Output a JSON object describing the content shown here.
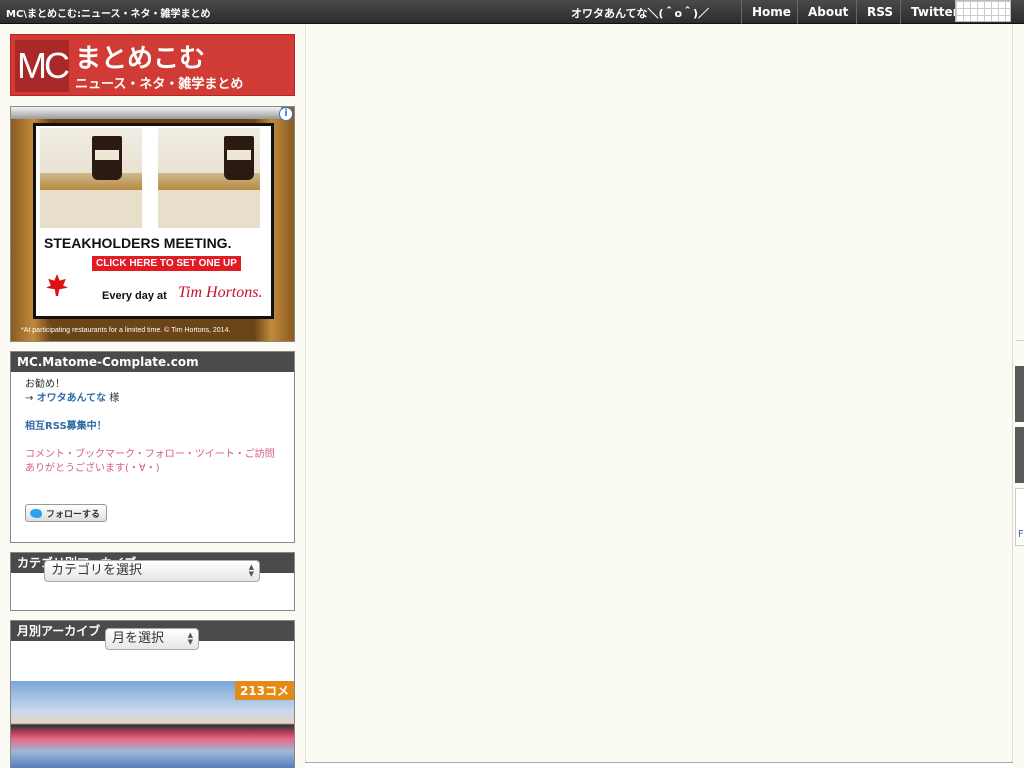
{
  "topbar": {
    "site_title": "MC\\まとめこむ:ニュース・ネタ・雑学まとめ",
    "tagline": "オワタあんてな＼(＾o＾)／",
    "nav": {
      "home": "Home",
      "about": "About",
      "rss": "RSS",
      "twitter": "Twitter"
    }
  },
  "logo": {
    "mark": "MC",
    "title": "まとめこむ",
    "subtitle": "ニュース・ネタ・雑学まとめ"
  },
  "ad": {
    "info": "i",
    "headline": "STEAKHOLDERS MEETING.",
    "cta": "CLICK HERE TO SET ONE UP",
    "tagline": "Every day at",
    "brand": "Tim Hortons.",
    "fine_print": "*At participating restaurants for a limited time. © Tim Hortons, 2014."
  },
  "profile_box": {
    "title": "MC.Matome-Complate.com",
    "recommend": "お勧め！",
    "arrow": "→",
    "link": "オワタあんてな",
    "honorific": "様",
    "mutual_rss": "相互RSS募集中！",
    "thanks": "コメント・ブックマーク・フォロー・ツイート・ご訪問ありがとうございます(・∀・)",
    "follow_button": "フォローする"
  },
  "category_archive": {
    "title": "カテゴリ別アーカイブ",
    "select": "カテゴリを選択"
  },
  "monthly_archive": {
    "title": "月別アーカイブ",
    "select": "月を選択"
  },
  "article_thumb": {
    "comments": "213コメ"
  },
  "right_edge": {
    "label": "F"
  },
  "colors": {
    "brand_red": "#d03b35",
    "header_dark": "#4a4a4a",
    "link_blue": "#2e6aa6",
    "pink": "#d55b86",
    "badge_orange": "#e38b18"
  }
}
